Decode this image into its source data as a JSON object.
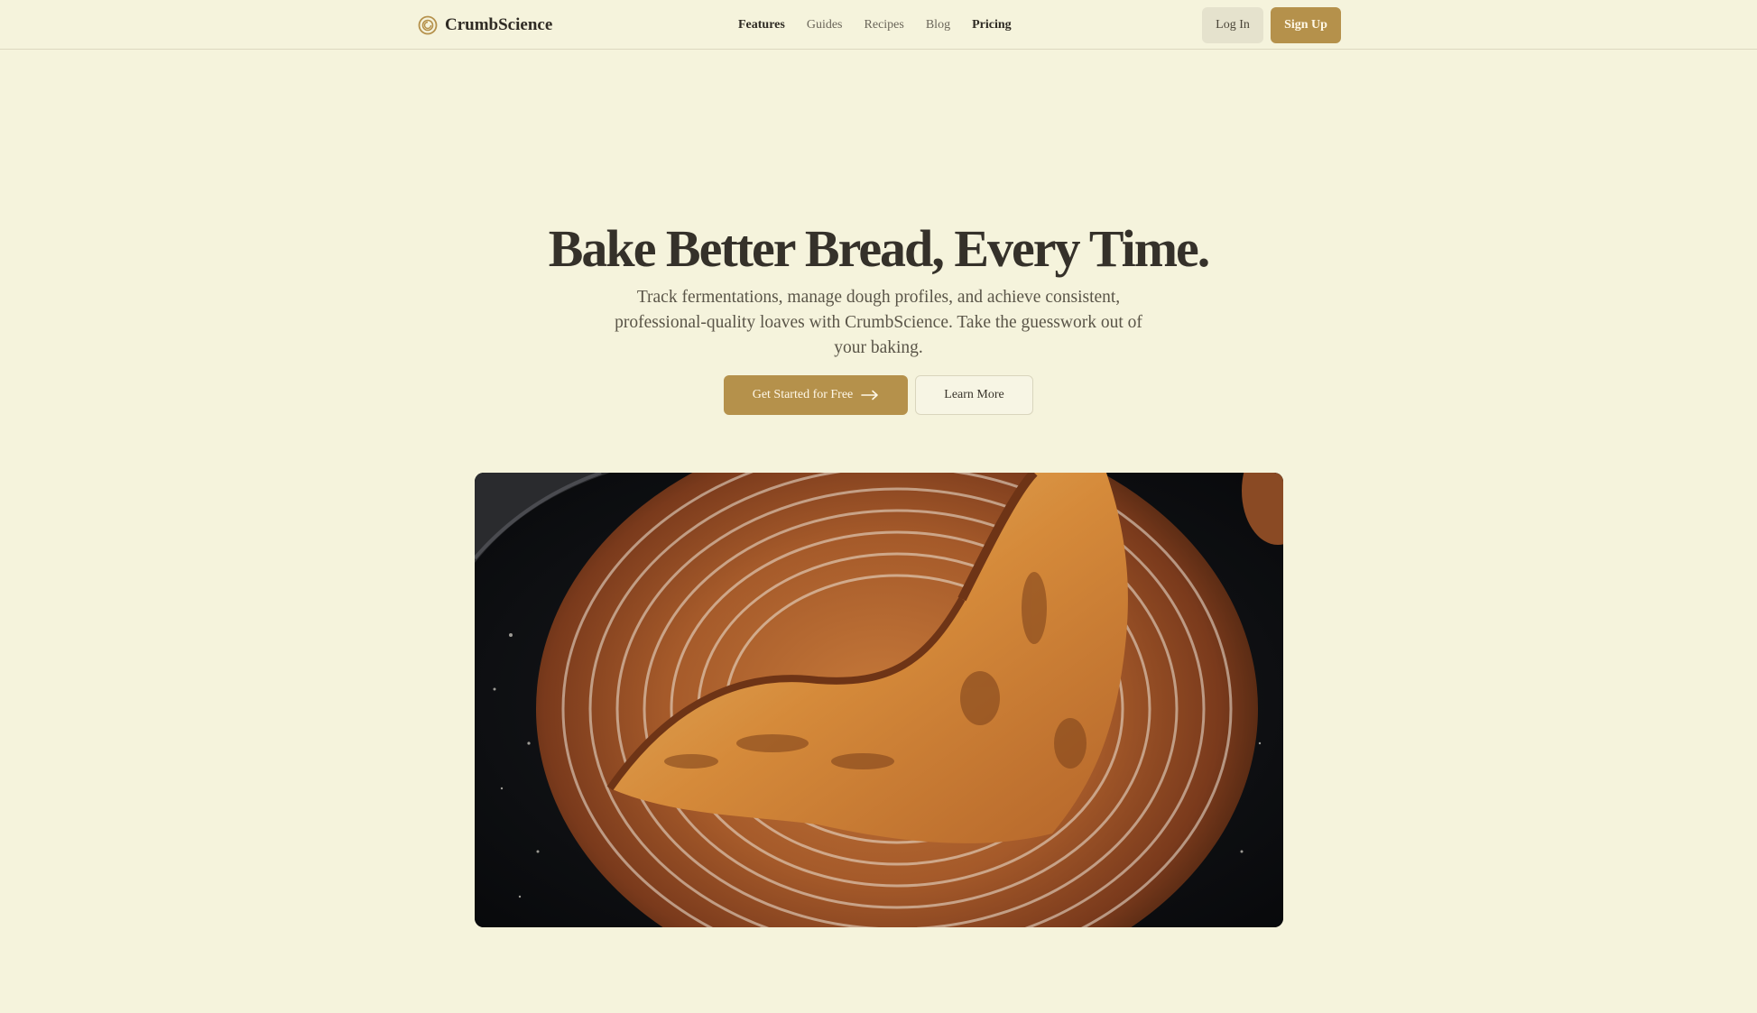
{
  "header": {
    "brand": {
      "name": "CrumbScience",
      "icon": "logo-swirl-icon"
    },
    "nav": [
      {
        "label": "Features",
        "emphasis": true
      },
      {
        "label": "Guides",
        "emphasis": false
      },
      {
        "label": "Recipes",
        "emphasis": false
      },
      {
        "label": "Blog",
        "emphasis": false
      },
      {
        "label": "Pricing",
        "emphasis": true
      }
    ],
    "login_label": "Log In",
    "signup_label": "Sign Up"
  },
  "hero": {
    "title": "Bake Better Bread, Every Time.",
    "subtitle": "Track fermentations, manage dough profiles, and achieve consistent, professional-quality loaves with CrumbScience. Take the guesswork out of your baking.",
    "primary_cta": "Get Started for Free",
    "primary_cta_icon": "arrow-right-icon",
    "secondary_cta": "Learn More",
    "image_subject": "scored sourdough loaf"
  },
  "colors": {
    "background": "#f5f3dc",
    "accent": "#b5914b",
    "text": "#35312a",
    "muted_button": "#e5e2cd"
  }
}
